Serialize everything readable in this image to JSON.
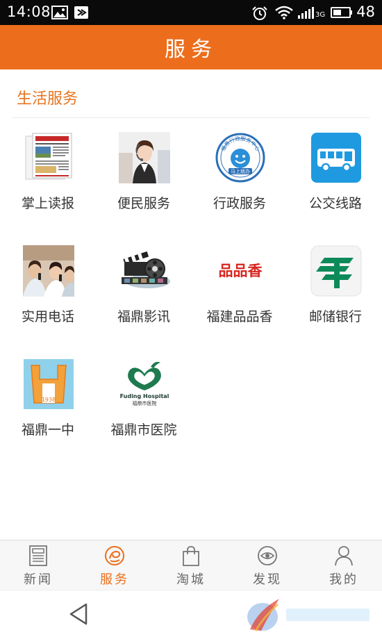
{
  "status_bar": {
    "time": "14:08",
    "network": "3G",
    "battery": "48"
  },
  "header": {
    "title": "服务"
  },
  "section": {
    "title": "生活服务"
  },
  "grid": [
    {
      "label": "掌上读报",
      "icon": "newspaper-icon"
    },
    {
      "label": "便民服务",
      "icon": "call-center-icon"
    },
    {
      "label": "行政服务",
      "icon": "admin-seal-icon"
    },
    {
      "label": "公交线路",
      "icon": "bus-icon"
    },
    {
      "label": "实用电话",
      "icon": "phone-people-icon"
    },
    {
      "label": "福鼎影讯",
      "icon": "film-icon"
    },
    {
      "label": "福建品品香",
      "icon": "pinpinxiang-logo-icon"
    },
    {
      "label": "邮储银行",
      "icon": "postal-bank-icon"
    },
    {
      "label": "福鼎一中",
      "icon": "school-icon"
    },
    {
      "label": "福鼎市医院",
      "icon": "hospital-icon"
    }
  ],
  "logos": {
    "admin_seal_ring": "福鼎行政服务中心",
    "admin_seal_center": "马上就办",
    "pinpinxiang": "品品香",
    "school_year": "1938",
    "hospital_en": "Fuding Hospital",
    "hospital_cn": "福鼎市医院"
  },
  "bottom_nav": [
    {
      "label": "新闻",
      "icon": "news-icon",
      "active": false
    },
    {
      "label": "服务",
      "icon": "service-icon",
      "active": true
    },
    {
      "label": "淘城",
      "icon": "shopping-bag-icon",
      "active": false
    },
    {
      "label": "发现",
      "icon": "eye-icon",
      "active": false
    },
    {
      "label": "我的",
      "icon": "user-icon",
      "active": false
    }
  ],
  "colors": {
    "accent": "#ec6e1c",
    "section_title": "#e8741f",
    "bus_blue": "#1f9ae0",
    "postal_green": "#0d8a5a",
    "pinpinxiang_red": "#d7251d"
  }
}
